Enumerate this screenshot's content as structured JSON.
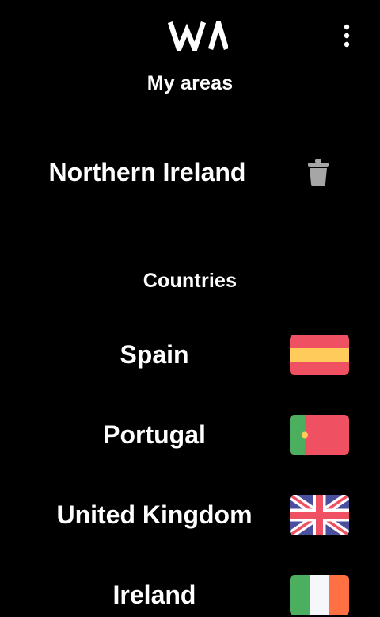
{
  "header": {
    "logo_text": "WA",
    "menu_icon": "more-vert-icon"
  },
  "my_areas": {
    "title": "My areas",
    "items": [
      {
        "name": "Northern Ireland",
        "action_icon": "trash-icon"
      }
    ]
  },
  "countries": {
    "title": "Countries",
    "items": [
      {
        "name": "Spain",
        "flag_icon": "spain-flag-icon"
      },
      {
        "name": "Portugal",
        "flag_icon": "portugal-flag-icon"
      },
      {
        "name": "United Kingdom",
        "flag_icon": "uk-flag-icon"
      },
      {
        "name": "Ireland",
        "flag_icon": "ireland-flag-icon"
      }
    ]
  },
  "colors": {
    "background": "#000000",
    "text": "#ffffff",
    "trash_icon": "#a6a6a6",
    "flag_red": "#ef5062",
    "flag_yellow": "#ffcc5c",
    "flag_green": "#4caf5f",
    "flag_blue": "#4a4f9e",
    "flag_orange": "#ff7043"
  }
}
